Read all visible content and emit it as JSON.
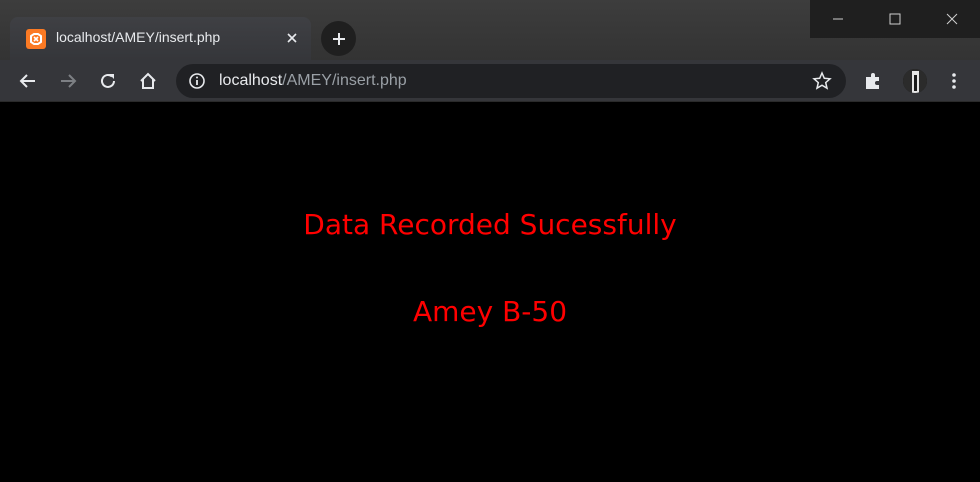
{
  "browser": {
    "tab": {
      "title": "localhost/AMEY/insert.php",
      "favicon": "xampp-icon"
    },
    "address_bar": {
      "host": "localhost",
      "path": "/AMEY/insert.php"
    },
    "icons": {
      "back": "back-arrow-icon",
      "forward": "forward-arrow-icon",
      "reload": "reload-icon",
      "home": "home-icon",
      "info": "info-icon",
      "bookmark": "star-icon",
      "extensions": "puzzle-icon",
      "menu": "kebab-menu-icon"
    }
  },
  "page": {
    "message": "Data Recorded Sucessfully",
    "name": "Amey B-50",
    "text_color": "#ff0000",
    "background": "#000000"
  }
}
